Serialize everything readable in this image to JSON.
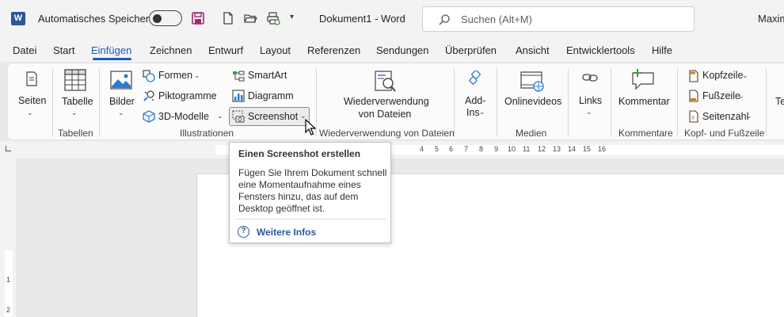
{
  "titlebar": {
    "autosave_label": "Automatisches Speichern",
    "doc_title": "Dokument1  -  Word",
    "search_placeholder": "Suchen (Alt+M)",
    "user_name": "Maxim"
  },
  "menu": {
    "tabs": [
      "Datei",
      "Start",
      "Einfügen",
      "Zeichnen",
      "Entwurf",
      "Layout",
      "Referenzen",
      "Sendungen",
      "Überprüfen",
      "Ansicht",
      "Entwicklertools",
      "Hilfe"
    ],
    "active": "Einfügen"
  },
  "ribbon": {
    "seiten": "Seiten",
    "tabelle": "Tabelle",
    "bilder": "Bilder",
    "formen": "Formen",
    "piktogramme": "Piktogramme",
    "modelle3d": "3D-Modelle",
    "smartart": "SmartArt",
    "diagramm": "Diagramm",
    "screenshot": "Screenshot",
    "wiederverwendung_line1": "Wiederverwendung",
    "wiederverwendung_line2": "von Dateien",
    "addins_line1": "Add-",
    "addins_line2": "Ins",
    "onlinevideos": "Onlinevideos",
    "links": "Links",
    "kommentar": "Kommentar",
    "kopfzeile": "Kopfzeile",
    "fusszeile": "Fußzeile",
    "seitenzahl": "Seitenzahl",
    "textfeld_partial": "Te",
    "groups": {
      "tabellen": "Tabellen",
      "illustrationen": "Illustrationen",
      "wiederverwendung": "Wiederverwendung von Dateien",
      "medien": "Medien",
      "kommentare": "Kommentare",
      "kopf_fuss": "Kopf- und Fußzeile"
    }
  },
  "ruler": {
    "numbers": [
      "4",
      "5",
      "6",
      "7",
      "8",
      "9",
      "10",
      "11",
      "12",
      "13",
      "14",
      "15",
      "16"
    ],
    "vertical_numbers": [
      "1",
      "2"
    ]
  },
  "tooltip": {
    "title": "Einen Screenshot erstellen",
    "body": "Fügen Sie Ihrem Dokument schnell eine Momentaufnahme eines Fensters hinzu, das auf dem Desktop geöffnet ist.",
    "link": "Weitere Infos",
    "help_glyph": "?"
  },
  "colors": {
    "accent": "#185abd",
    "word_blue": "#2b579a",
    "save_purple": "#a4266d"
  },
  "icons": [
    "word-logo-icon",
    "save-icon",
    "new-document-icon",
    "open-folder-icon",
    "print-preview-icon",
    "customize-qat-icon",
    "search-icon",
    "pages-icon",
    "table-icon",
    "pictures-icon",
    "shapes-icon",
    "icons-icon",
    "3d-models-icon",
    "smartart-icon",
    "chart-icon",
    "screenshot-icon",
    "reuse-files-icon",
    "add-ins-icon",
    "online-video-icon",
    "link-icon",
    "comment-icon",
    "header-icon",
    "footer-icon",
    "page-number-icon",
    "help-icon",
    "mouse-cursor-icon"
  ]
}
